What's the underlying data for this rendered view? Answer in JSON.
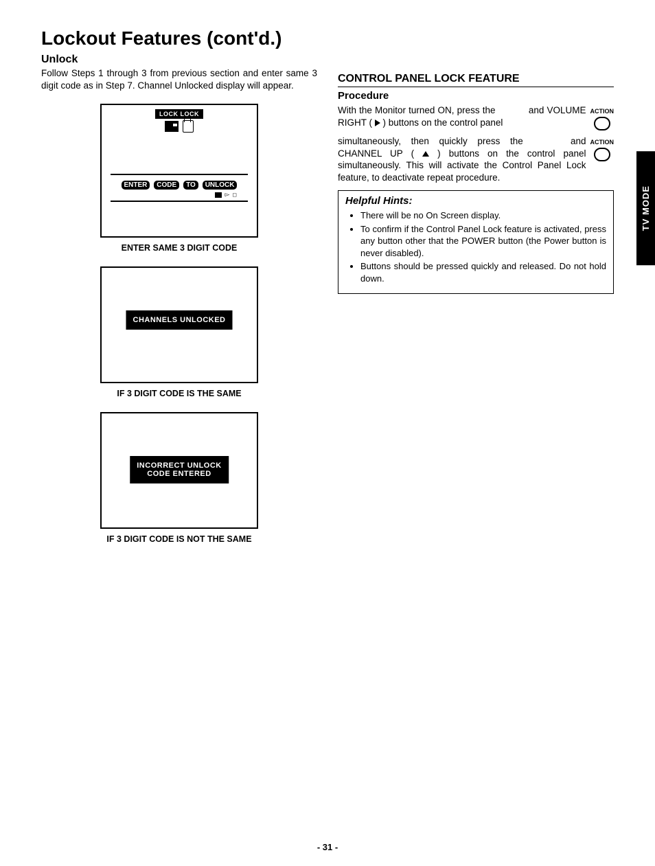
{
  "page_title": "Lockout Features (cont'd.)",
  "side_tab": "TV MODE",
  "page_number": "- 31 -",
  "left": {
    "unlock_heading": "Unlock",
    "unlock_text": "Follow Steps 1 through 3 from previous section and enter same 3 digit code as in Step 7. Channel Unlocked display will appear.",
    "screen1": {
      "top_bar": "LOCK   LOCK",
      "enter_words": [
        "ENTER",
        "CODE",
        "TO",
        "UNLOCK"
      ],
      "caption": "ENTER SAME 3 DIGIT CODE"
    },
    "screen2": {
      "message": "CHANNELS UNLOCKED",
      "caption": "IF 3 DIGIT CODE IS THE SAME"
    },
    "screen3": {
      "message": "INCORRECT UNLOCK\nCODE ENTERED",
      "caption": "IF 3 DIGIT CODE IS NOT THE SAME"
    }
  },
  "right": {
    "cpl_heading": "CONTROL PANEL LOCK FEATURE",
    "procedure_heading": "Procedure",
    "action_label": "ACTION",
    "para1_a": "With the Monitor turned ON, press the ",
    "para1_b": " and VOLUME RIGHT ( ",
    "para1_c": " ) buttons on the control panel",
    "para2_a": "simultaneously, then quickly press the ",
    "para2_b": " and CHANNEL UP ( ",
    "para2_c": " ) buttons on the control panel simultaneously. This will activate the Control Panel Lock feature, to deactivate repeat procedure.",
    "hints_title": "Helpful Hints:",
    "hints": [
      "There will be no On Screen display.",
      "To confirm if the Control Panel Lock feature is activated, press any button other that the POWER button (the Power button is never disabled).",
      "Buttons should be pressed quickly and released. Do not hold down."
    ]
  }
}
